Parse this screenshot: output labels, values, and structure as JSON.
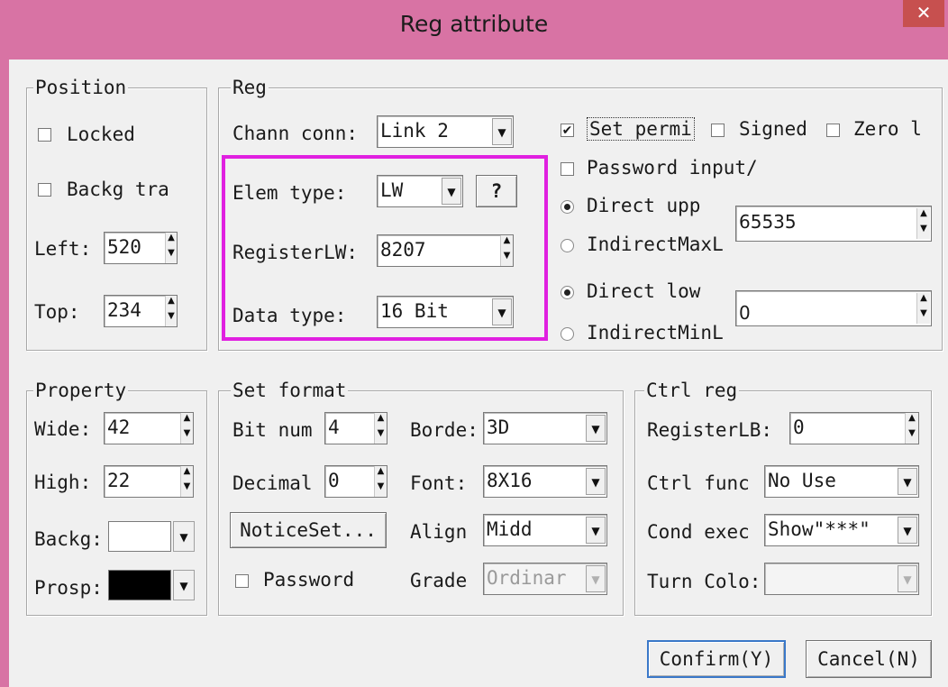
{
  "window": {
    "title": "Reg attribute",
    "close_symbol": "✕"
  },
  "position": {
    "legend": "Position",
    "locked_label": "Locked",
    "backg_transparent_label": "Backg tra",
    "left_label": "Left:",
    "left_value": "520",
    "top_label": "Top:",
    "top_value": "234"
  },
  "reg": {
    "legend": "Reg",
    "chann_conn_label": "Chann conn:",
    "chann_conn_value": "Link 2",
    "elem_type_label": "Elem type:",
    "elem_type_value": "LW",
    "help_button": "?",
    "register_label": "RegisterLW:",
    "register_value": "8207",
    "data_type_label": "Data type:",
    "data_type_value": "16 Bit",
    "set_permit_label": "Set permi",
    "set_permit_checked": "✔",
    "signed_label": "Signed",
    "zero_label": "Zero l",
    "password_input_label": "Password input/",
    "direct_upper_label": "Direct upp",
    "direct_upper_value": "65535",
    "indirect_max_label": "IndirectMaxL",
    "direct_lower_label": "Direct low",
    "direct_lower_value": "0",
    "indirect_min_label": "IndirectMinL"
  },
  "property": {
    "legend": "Property",
    "wide_label": "Wide:",
    "wide_value": "42",
    "high_label": "High:",
    "high_value": "22",
    "backg_label": "Backg:",
    "backg_color": "#ffffff",
    "prosp_label": "Prosp:",
    "prosp_color": "#000000"
  },
  "set_format": {
    "legend": "Set format",
    "bit_num_label": "Bit num",
    "bit_num_value": "4",
    "decimal_label": "Decimal",
    "decimal_value": "0",
    "notice_button": "NoticeSet...",
    "password_label": "Password",
    "border_label": "Borde:",
    "border_value": "3D",
    "font_label": "Font:",
    "font_value": "8X16",
    "align_label": "Align",
    "align_value": "Midd",
    "grade_label": "Grade",
    "grade_value": "Ordinar"
  },
  "ctrl_reg": {
    "legend": "Ctrl reg",
    "register_lb_label": "RegisterLB:",
    "register_lb_value": "0",
    "ctrl_func_label": "Ctrl func",
    "ctrl_func_value": "No Use",
    "cond_exec_label": "Cond exec",
    "cond_exec_value": "Show\"***\"",
    "turn_color_label": "Turn Colo:",
    "turn_color_value": ""
  },
  "buttons": {
    "confirm": "Confirm(Y)",
    "cancel": "Cancel(N)"
  },
  "colors": {
    "titlebar": "#d873a4",
    "close": "#c7504f",
    "highlight": "#e020e0"
  }
}
